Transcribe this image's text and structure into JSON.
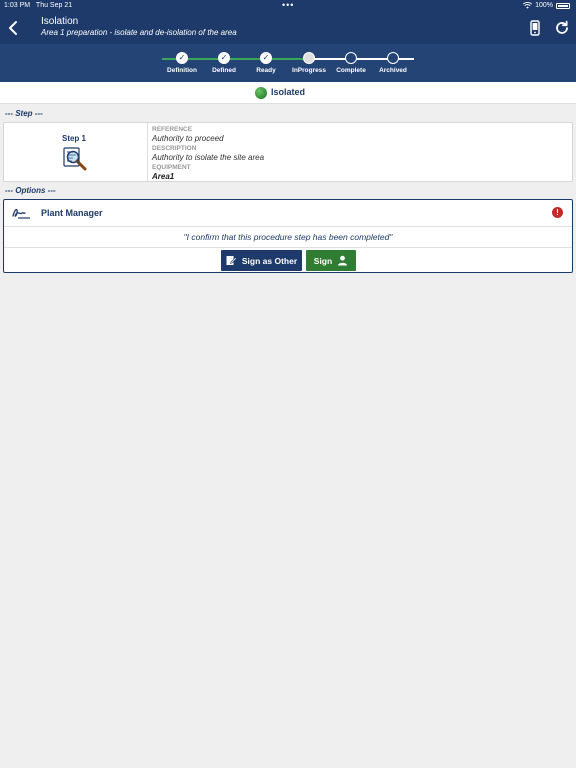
{
  "status_bar": {
    "time": "1:03 PM",
    "date": "Thu Sep 21",
    "dots": "•••",
    "battery_text": "100%"
  },
  "header": {
    "title": "Isolation",
    "subtitle": "Area 1 preparation - isolate and de-isolation of the area"
  },
  "stepper": {
    "stages": [
      {
        "label": "Definition",
        "state": "done"
      },
      {
        "label": "Defined",
        "state": "done"
      },
      {
        "label": "Ready",
        "state": "done"
      },
      {
        "label": "InProgress",
        "state": "current"
      },
      {
        "label": "Complete",
        "state": "pending"
      },
      {
        "label": "Archived",
        "state": "pending"
      }
    ],
    "check_glyph": "✓"
  },
  "state": {
    "text": "Isolated",
    "color": "#3a9a3a"
  },
  "step_section": {
    "label": "--- Step ---"
  },
  "step": {
    "name": "Step 1",
    "reference_label": "REFERENCE",
    "reference_value": "Authority to proceed",
    "description_label": "DESCRIPTION",
    "description_value": "Authority to isolate the site area",
    "equipment_label": "EQUIPMENT",
    "equipment_value": "Area1"
  },
  "options_section": {
    "label": "--- Options ---"
  },
  "option": {
    "role": "Plant Manager",
    "alert_glyph": "!",
    "confirm_text": "\"I confirm that this procedure step has been completed\"",
    "sign_other_label": "Sign as Other",
    "sign_label": "Sign"
  },
  "colors": {
    "primary": "#1d3a6a",
    "success": "#2f7d32",
    "alert": "#c62828"
  }
}
